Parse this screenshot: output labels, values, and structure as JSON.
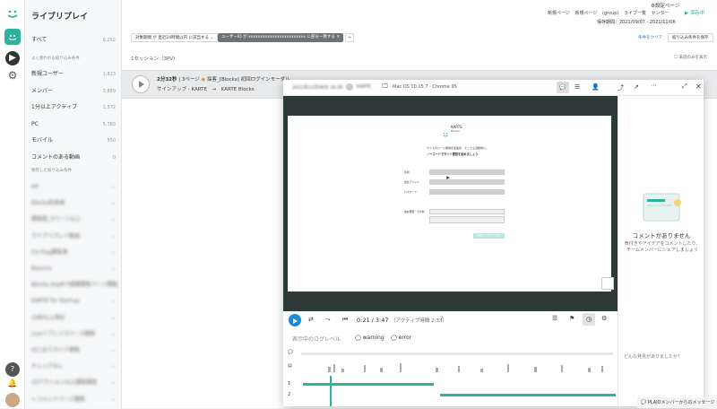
{
  "app": {
    "title": "ライブリプレイ"
  },
  "rail": {
    "icons": [
      "karte-logo-icon",
      "replay-icon",
      "settings-icon",
      "help-icon",
      "bell-icon",
      "avatar"
    ]
  },
  "sidebar": {
    "all_label": "すべて",
    "all_count": "6,252",
    "frequent_header": "よく使われる絞り込み条件",
    "frequent": [
      {
        "label": "新規ユーザー",
        "count": "1,823"
      },
      {
        "label": "メンバー",
        "count": "3,889"
      },
      {
        "label": "1分以上アクティブ",
        "count": "1,572"
      },
      {
        "label": "PC",
        "count": "5,783"
      },
      {
        "label": "モバイル",
        "count": "550"
      },
      {
        "label": "コメントのある動画",
        "count": "0"
      }
    ],
    "saved_header": "保存した絞り込み条件",
    "saved": [
      {
        "label": "HP",
        "count": "—"
      },
      {
        "label": "Blocks利用者",
        "count": "—"
      },
      {
        "label": "閲覧数_3ページ以上",
        "count": "—"
      },
      {
        "label": "ライブリプレイ動画",
        "count": "—"
      },
      {
        "label": "CV Flag閲覧者",
        "count": "—"
      },
      {
        "label": "Bounce",
        "count": "—"
      },
      {
        "label": "Blocks dayNで経験閲覧ページ閲覧",
        "count": "—"
      },
      {
        "label": "KARTE for Startup",
        "count": "—"
      },
      {
        "label": "10秒以上滞在",
        "count": "—"
      },
      {
        "label": "Liveリプレイスペース閲覧",
        "count": "—"
      },
      {
        "label": "はじめてガイド閲覧",
        "count": "—"
      },
      {
        "label": "チェックなし",
        "count": "—"
      },
      {
        "label": "10アクション以上閲覧閲覧",
        "count": "—"
      },
      {
        "label": "レコメンドページ閲覧",
        "count": "—"
      }
    ]
  },
  "topbar": {
    "settings_link": "設定ページ",
    "actions": [
      "新規ページ",
      "新規ページ",
      "(group)",
      "ライブ一覧",
      "センター"
    ],
    "save_button": "保存中",
    "retention_label": "保存期間：2021/09/07 - 2021/11/06"
  },
  "filters": {
    "period_chip": "対象期間 が 直近24時間以内 に該当する",
    "user_chip": "ユーザーID が xxxxxxxxxxxxxxxxxxxxxxxx に部分一致する",
    "clear_link": "条件をクリア",
    "save_filter": "絞り込み条件を保存"
  },
  "summary": {
    "text": "1セッション（3PV）",
    "unread_only": "未読のみを表示"
  },
  "session": {
    "duration": "2分32秒",
    "pages": "3ページ",
    "title": "採客_[Blocks] 初回ログインモーダル...",
    "sub": "サインアップ - KARTE　→　KARTE Blocks"
  },
  "modal": {
    "date": "2021年11月06日 16:30",
    "user": "KARTE",
    "os": "Mac OS 10.15.7 · Chrome 95",
    "preview": {
      "brand": "KARTE",
      "brand_sub": "Blocks",
      "heading1": "サイトのリード獲得を最速化、そこでも活動的に。",
      "heading2": "ノーコードでサイト運営を始めましょう",
      "field_labels": [
        "名前",
        "会社アドレス",
        "パスワード",
        "会社概要・その他"
      ],
      "cta": "無料でアカウント作成"
    },
    "player": {
      "time": "0:21 / 3:47",
      "active": "（アクティブ時間 2:33）"
    },
    "log_level": {
      "label": "表示中のログレベル",
      "warning": "warning",
      "error": "error"
    },
    "timeline_rows": [
      "1",
      "2"
    ],
    "comments": {
      "empty_title": "コメントがありません",
      "empty_desc": "気付きやアイデアをコメントしたり、チームメンバーにシェアしましょう",
      "prompt": "どんな発見がありましたか？"
    },
    "footer": "PLAIDメンバーからのメッセージ"
  },
  "colors": {
    "accent": "#2bb39b",
    "dark_player": "#2e3a37",
    "blue_play": "#1e8ad6"
  }
}
